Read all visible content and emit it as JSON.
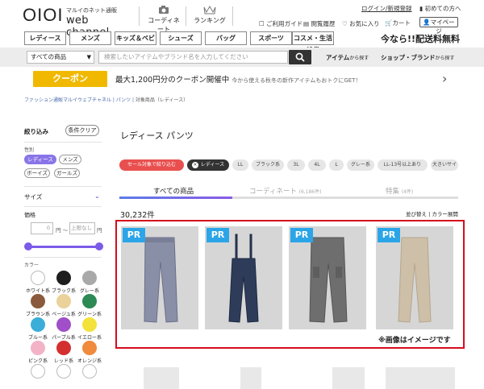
{
  "header": {
    "logo_mark": "OIOI",
    "logo_sub": "マルイのネット通販",
    "logo_name": "web channel",
    "coordinate_label": "コーディネート",
    "ranking_label": "ランキング",
    "login_link": "ログイン/新規登録",
    "first_time_link": "初めての方へ",
    "guide_link": "ご利用ガイド",
    "history_link": "閲覧履歴",
    "favorites_link": "お気に入り",
    "cart_link": "カート",
    "mypage_button": "マイページ"
  },
  "category_nav": {
    "items": [
      "レディース",
      "メンズ",
      "キッズ＆ベビー",
      "シューズ",
      "バッグ",
      "スポーツ",
      "コスメ・生活雑貨"
    ],
    "promo": "今なら!!配送料無料"
  },
  "search": {
    "category_value": "すべての商品",
    "placeholder": "検索したいアイテムやブランド名を入力してください",
    "item_search_label": "アイテム",
    "item_search_suffix": "から探す",
    "shop_search_label": "ショップ・ブランド",
    "shop_search_suffix": "から探す"
  },
  "coupon": {
    "button_label": "クーポン",
    "headline": "最大1,200円分のクーポン開催中",
    "subtext": "今から使える秋冬の新作アイテムもおトクにGET！"
  },
  "breadcrumb": {
    "path": "ファッション通販マルイウェブチャネル | パンツ | ",
    "current": "対象商品（レディース）"
  },
  "filter": {
    "title": "絞り込み",
    "clear_button": "条件クリア",
    "gender_label": "性別",
    "gender_options": [
      "レディース",
      "メンズ",
      "ボーイズ",
      "ガールズ"
    ],
    "gender_selected": "レディース",
    "size_label": "サイズ",
    "price_label": "価格",
    "price_min_value": "0",
    "price_min_unit": "円 〜",
    "price_max_placeholder": "上限なし",
    "price_max_unit": "円",
    "color_label": "カラー",
    "colors": [
      {
        "name": "ホワイト系",
        "hex": "#ffffff"
      },
      {
        "name": "ブラック系",
        "hex": "#1e1e1e"
      },
      {
        "name": "グレー系",
        "hex": "#a9a9a9"
      },
      {
        "name": "ブラウン系",
        "hex": "#8b5a3c"
      },
      {
        "name": "ベージュ系",
        "hex": "#ead29a"
      },
      {
        "name": "グリーン系",
        "hex": "#2e8a55"
      },
      {
        "name": "ブルー系",
        "hex": "#3aaed8"
      },
      {
        "name": "パープル系",
        "hex": "#a04fc8"
      },
      {
        "name": "イエロー系",
        "hex": "#f2e23a"
      },
      {
        "name": "ピンク系",
        "hex": "#f3b3c6"
      },
      {
        "name": "レッド系",
        "hex": "#d42f2f"
      },
      {
        "name": "オレンジ系",
        "hex": "#f08a3c"
      },
      {
        "name": "",
        "hex": "#ffffff"
      },
      {
        "name": "",
        "hex": "#ffffff"
      },
      {
        "name": "",
        "hex": "#ffffff"
      }
    ]
  },
  "main": {
    "title": "レディース パンツ",
    "filter_pills": [
      "セール対象で絞り込む",
      "レディース",
      "LL",
      "ブラック系",
      "3L",
      "4L",
      "L",
      "グレー系",
      "LL-13号以上あり",
      "大きいサイ"
    ],
    "tabs": [
      {
        "label": "すべての商品",
        "count": ""
      },
      {
        "label": "コーディネート",
        "count": "(6,186件)"
      },
      {
        "label": "特集",
        "count": "(4件)"
      }
    ],
    "result_count": "30,232件",
    "sort_label": "並び替え",
    "display_label": "カラー展開",
    "pr_badge": "PR",
    "image_note": "※画像はイメージです"
  }
}
